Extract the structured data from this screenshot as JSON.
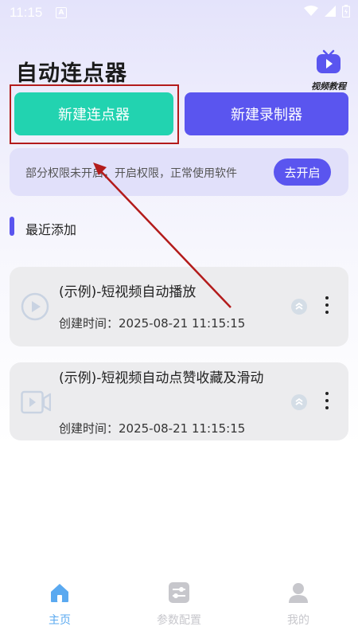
{
  "status_bar": {
    "time": "11:15",
    "notification_letter": "A"
  },
  "header": {
    "title": "自动连点器",
    "video_tutorial_label": "视频教程"
  },
  "actions": {
    "new_clicker": "新建连点器",
    "new_recorder": "新建录制器"
  },
  "permission_banner": {
    "message": "部分权限未开启，开启权限，正常使用软件",
    "button": "去开启"
  },
  "recent": {
    "title": "最近添加",
    "items": [
      {
        "title": "(示例)-短视频自动播放",
        "created": "创建时间：2025-08-21 11:15:15"
      },
      {
        "title": "(示例)-短视频自动点赞收藏及滑动",
        "created": "创建时间：2025-08-21 11:15:15"
      }
    ]
  },
  "bottom_nav": {
    "items": [
      {
        "label": "主页"
      },
      {
        "label": "参数配置"
      },
      {
        "label": "我的"
      }
    ]
  },
  "colors": {
    "accent": "#5a55ef",
    "teal": "#22d3b0",
    "annotation_red": "#b31b1b",
    "nav_active": "#5aa9f0",
    "nav_inactive": "#c7c7cc"
  }
}
